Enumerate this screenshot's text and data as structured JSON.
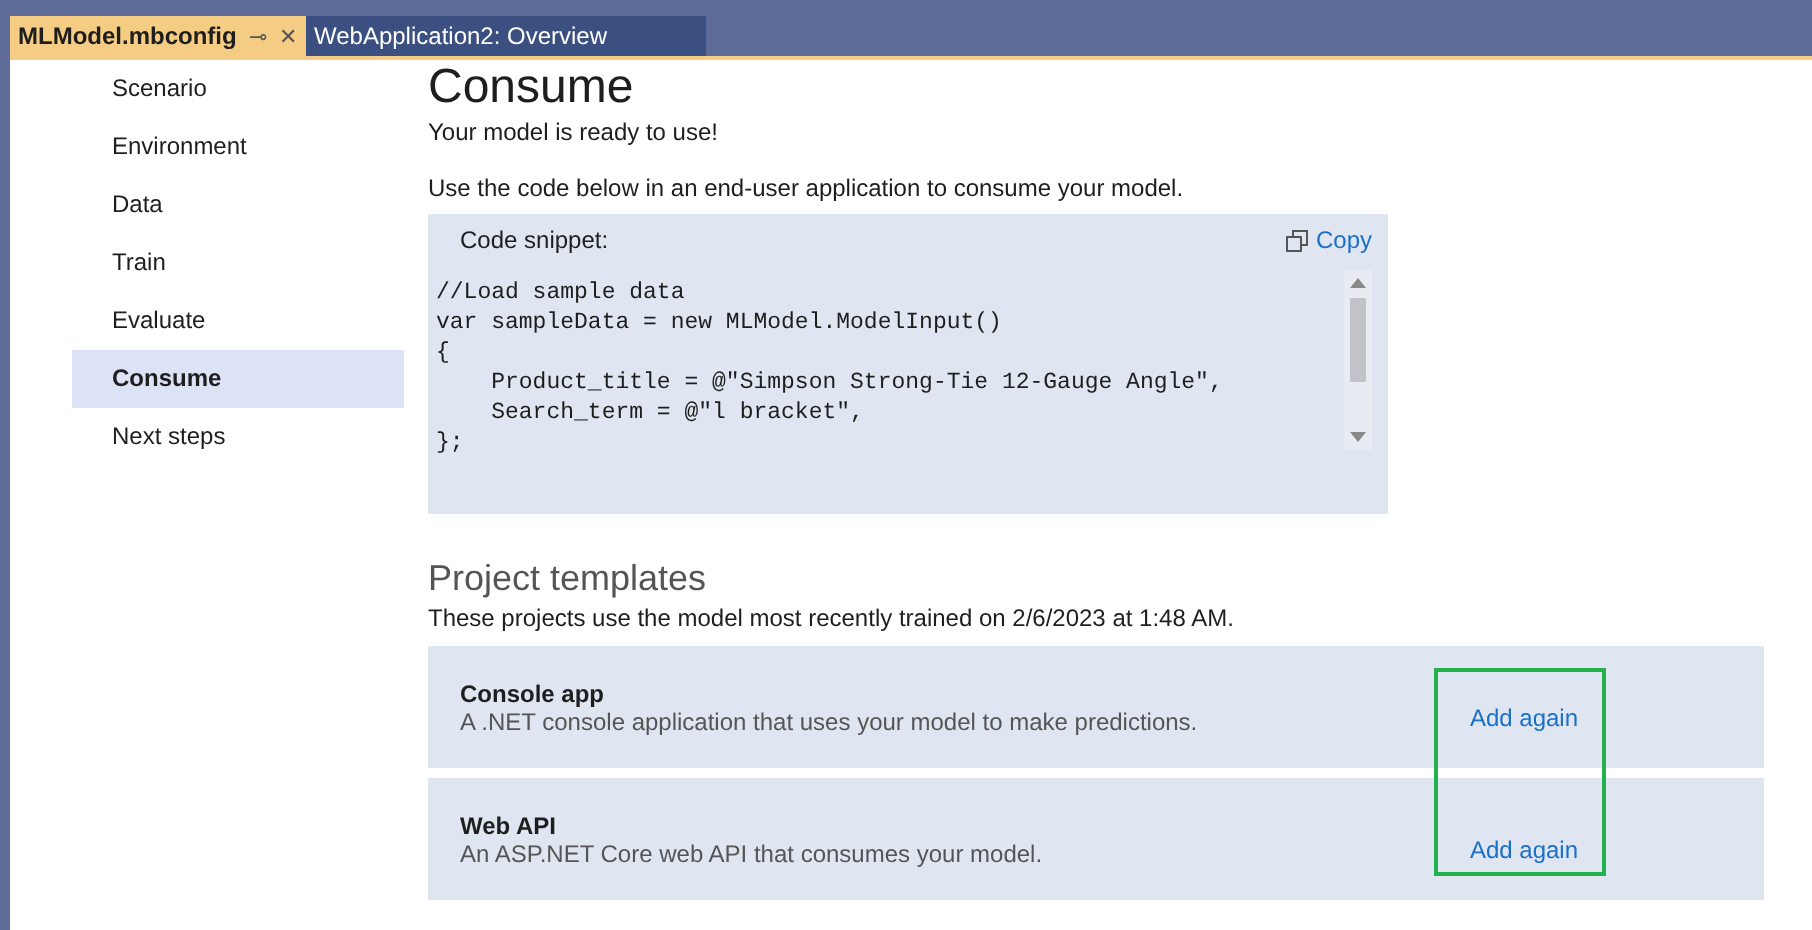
{
  "tabs": [
    {
      "label": "MLModel.mbconfig",
      "selected": true,
      "pin": "⊸",
      "close": "✕"
    },
    {
      "label": "WebApplication2: Overview",
      "selected": false
    }
  ],
  "sidebar": {
    "items": [
      {
        "label": "Scenario",
        "selected": false
      },
      {
        "label": "Environment",
        "selected": false
      },
      {
        "label": "Data",
        "selected": false
      },
      {
        "label": "Train",
        "selected": false
      },
      {
        "label": "Evaluate",
        "selected": false
      },
      {
        "label": "Consume",
        "selected": true
      },
      {
        "label": "Next steps",
        "selected": false
      }
    ]
  },
  "heading": "Consume",
  "status": "Your model is ready to use!",
  "intro": "Use the code below in an end-user application to consume your model.",
  "code_snippet": {
    "label": "Code snippet:",
    "copy": "Copy",
    "lines": [
      "//Load sample data",
      "var sampleData = new MLModel.ModelInput()",
      "{",
      "    Product_title = @\"Simpson Strong-Tie 12-Gauge Angle\",",
      "    Search_term = @\"l bracket\",",
      "};"
    ]
  },
  "templates": {
    "title": "Project templates",
    "note": "These projects use the model most recently trained on 2/6/2023 at 1:48 AM.",
    "items": [
      {
        "name": "Console app",
        "description": "A .NET console application that uses your model to make predictions.",
        "action": "Add again"
      },
      {
        "name": "Web API",
        "description": "An ASP.NET Core web API that consumes your model.",
        "action": "Add again"
      }
    ],
    "highlighted": true
  }
}
